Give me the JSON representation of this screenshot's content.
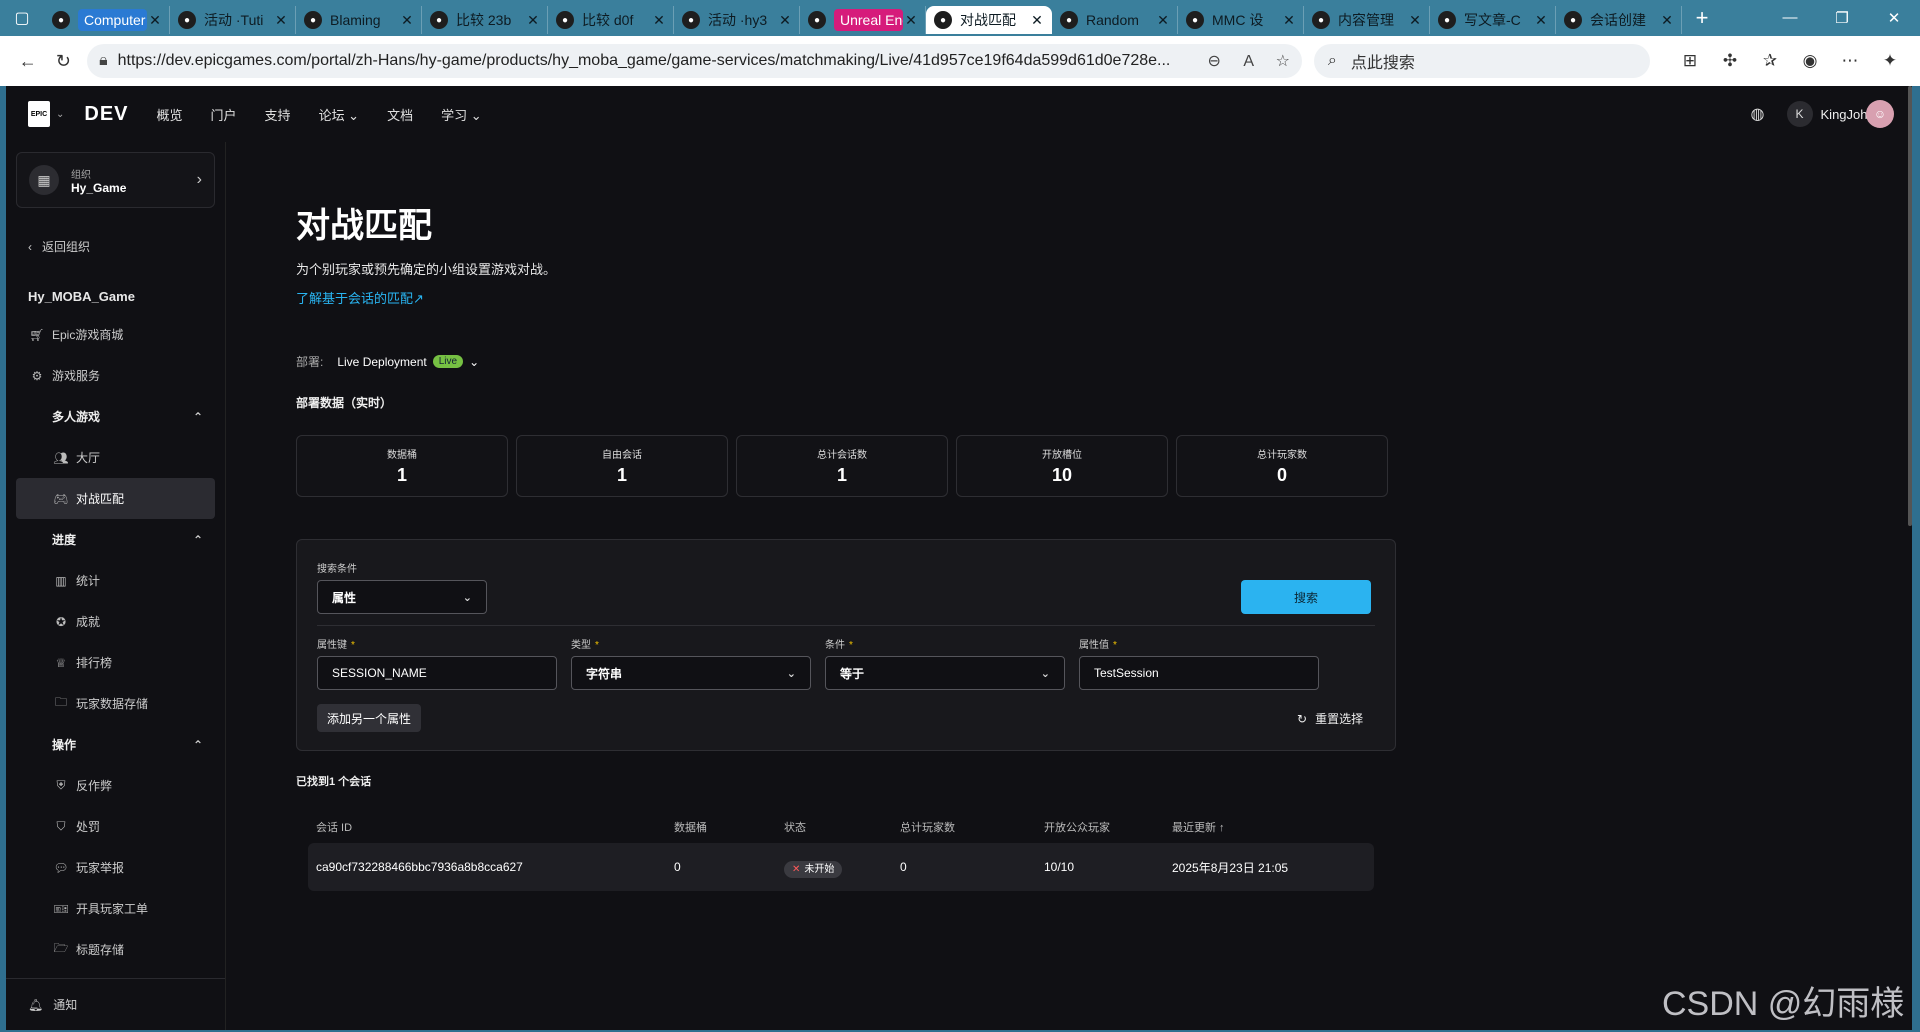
{
  "browser": {
    "tabs": [
      {
        "label": "Computer Prog",
        "style": "pill-blue"
      },
      {
        "label": "活动 ·Tuti",
        "style": ""
      },
      {
        "label": "Blaming",
        "style": ""
      },
      {
        "label": "比较 23b",
        "style": ""
      },
      {
        "label": "比较 d0f",
        "style": ""
      },
      {
        "label": "活动 ·hy3",
        "style": ""
      },
      {
        "label": "Unreal Engine",
        "style": "pill-pink"
      },
      {
        "label": "对战匹配",
        "style": "active"
      },
      {
        "label": "Random",
        "style": ""
      },
      {
        "label": "MMC 设",
        "style": ""
      },
      {
        "label": "内容管理",
        "style": ""
      },
      {
        "label": "写文章-C",
        "style": ""
      },
      {
        "label": "会话创建",
        "style": ""
      }
    ],
    "url": "https://dev.epicgames.com/portal/zh-Hans/hy-game/products/hy_moba_game/game-services/matchmaking/Live/41d957ce19f64da599d61d0e728e...",
    "search_placeholder": "点此搜索"
  },
  "topnav": {
    "logo_text": "EPIC",
    "brand": "DEV",
    "items": [
      "概览",
      "门户",
      "支持",
      "论坛 ⌄",
      "文档",
      "学习 ⌄"
    ],
    "avatar_letter": "K",
    "username": "KingJohy"
  },
  "sidebar": {
    "org_label": "组织",
    "org_name": "Hy_Game",
    "back_label": "返回组织",
    "game_name": "Hy_MOBA_Game",
    "store_label": "Epic游戏商城",
    "services_label": "游戏服务",
    "section_multiplayer": "多人游戏",
    "lobby": "大厅",
    "matchmaking": "对战匹配",
    "section_progress": "进度",
    "stats": "统计",
    "achievements": "成就",
    "leaderboards": "排行榜",
    "player_storage": "玩家数据存储",
    "section_ops": "操作",
    "anticheat": "反作弊",
    "sanctions": "处罚",
    "player_reports": "玩家举报",
    "player_tickets": "开具玩家工单",
    "title_storage": "标题存储",
    "notifications": "通知"
  },
  "main": {
    "title": "对战匹配",
    "subtitle": "为个别玩家或预先确定的小组设置游戏对战。",
    "learn_link": "了解基于会话的匹配↗",
    "deploy_label": "部署:",
    "deploy_value": "Live Deployment",
    "live_badge": "Live",
    "data_title": "部署数据（实时）",
    "stats": [
      {
        "label": "数据桶",
        "value": "1"
      },
      {
        "label": "自由会话",
        "value": "1"
      },
      {
        "label": "总计会话数",
        "value": "1"
      },
      {
        "label": "开放槽位",
        "value": "10"
      },
      {
        "label": "总计玩家数",
        "value": "0"
      }
    ],
    "search": {
      "criteria_label": "搜索条件",
      "criteria_value": "属性",
      "search_button": "搜索",
      "key_label": "属性键",
      "type_label": "类型",
      "cond_label": "条件",
      "value_label": "属性值",
      "key_value": "SESSION_NAME",
      "type_value": "字符串",
      "cond_value": "等于",
      "value_value": "TestSession",
      "add_button": "添加另一个属性",
      "reset_label": "重置选择"
    },
    "found_text": "已找到1 个会话",
    "table": {
      "headers": [
        "会话 ID",
        "数据桶",
        "状态",
        "总计玩家数",
        "开放公众玩家",
        "最近更新 ↑"
      ],
      "rows": [
        {
          "id": "ca90cf732288466bbc7936a8b8cca627",
          "bucket": "0",
          "status": "未开始",
          "players": "0",
          "open": "10/10",
          "updated": "2025年8月23日 21:05"
        }
      ]
    }
  },
  "watermark": "CSDN @幻雨様"
}
